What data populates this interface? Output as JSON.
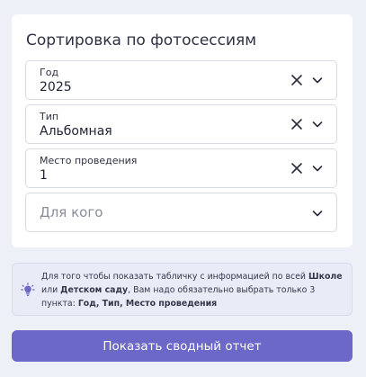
{
  "filters_card": {
    "title": "Сортировка по фотосессиям",
    "fields": [
      {
        "label": "Год",
        "value": "2025"
      },
      {
        "label": "Тип",
        "value": "Альбомная"
      },
      {
        "label": "Место проведения",
        "value": "1"
      },
      {
        "placeholder": "Для кого"
      }
    ],
    "icons": {
      "clear": "close-icon",
      "chevron": "chevron-down-icon"
    }
  },
  "info": {
    "icon": "lightbulb-icon",
    "text_1": "Для того чтобы показать табличку с информацией по всей ",
    "bold_1": "Школе",
    "text_2": " или ",
    "bold_2": "Детском саду",
    "text_3": ", Вам надо обязательно выбрать только 3 пункта: ",
    "bold_3": "Год, Тип, Место проведения"
  },
  "actions": {
    "report_button": "Показать сводный отчет"
  },
  "colors": {
    "accent": "#6b68c7",
    "background": "#eef0f8",
    "info_background": "#e9ecf7"
  }
}
